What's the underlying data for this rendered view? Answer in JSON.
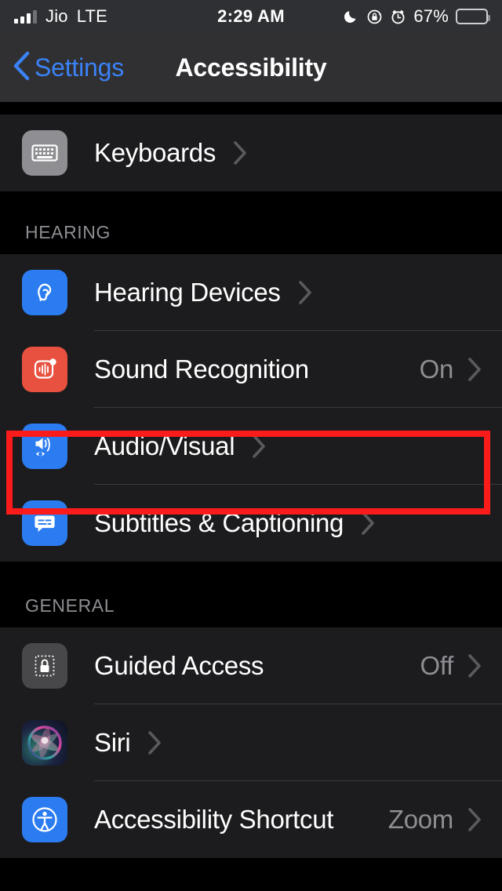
{
  "status_bar": {
    "carrier": "Jio",
    "network_mode": "LTE",
    "time": "2:29 AM",
    "battery_percent": "67%",
    "battery_level": 67,
    "icons": [
      "signal-bars-icon",
      "moon-icon",
      "rotation-lock-icon",
      "alarm-clock-icon",
      "battery-icon"
    ]
  },
  "nav_bar": {
    "back_label": "Settings",
    "title": "Accessibility",
    "back_icon": "chevron-left-icon",
    "accent_color": "#3b82f6"
  },
  "sections": [
    {
      "header": "",
      "rows": [
        {
          "label": "Keyboards",
          "value": "",
          "icon": "keyboard-icon",
          "icon_style": "ic-gray"
        }
      ]
    },
    {
      "header": "HEARING",
      "rows": [
        {
          "label": "Hearing Devices",
          "value": "",
          "icon": "ear-icon",
          "icon_style": "ic-blue"
        },
        {
          "label": "Sound Recognition",
          "value": "On",
          "icon": "sound-waveform-icon",
          "icon_style": "ic-red"
        },
        {
          "label": "Audio/Visual",
          "value": "",
          "icon": "speaker-eye-icon",
          "icon_style": "ic-blue"
        },
        {
          "label": "Subtitles & Captioning",
          "value": "",
          "icon": "caption-bubble-icon",
          "icon_style": "ic-blue"
        }
      ]
    },
    {
      "header": "GENERAL",
      "rows": [
        {
          "label": "Guided Access",
          "value": "Off",
          "icon": "lock-dotted-icon",
          "icon_style": "ic-dark"
        },
        {
          "label": "Siri",
          "value": "",
          "icon": "siri-orb-icon",
          "icon_style": "ic-siri"
        },
        {
          "label": "Accessibility Shortcut",
          "value": "Zoom",
          "icon": "accessibility-person-icon",
          "icon_style": "ic-blue"
        }
      ]
    }
  ],
  "highlight": {
    "target": "Audio/Visual",
    "color": "#fc1b1b"
  },
  "colors": {
    "row_background": "#1c1c1e",
    "page_background": "#000000",
    "separator": "#3a3a3c",
    "secondary_text": "#8d8d93"
  }
}
